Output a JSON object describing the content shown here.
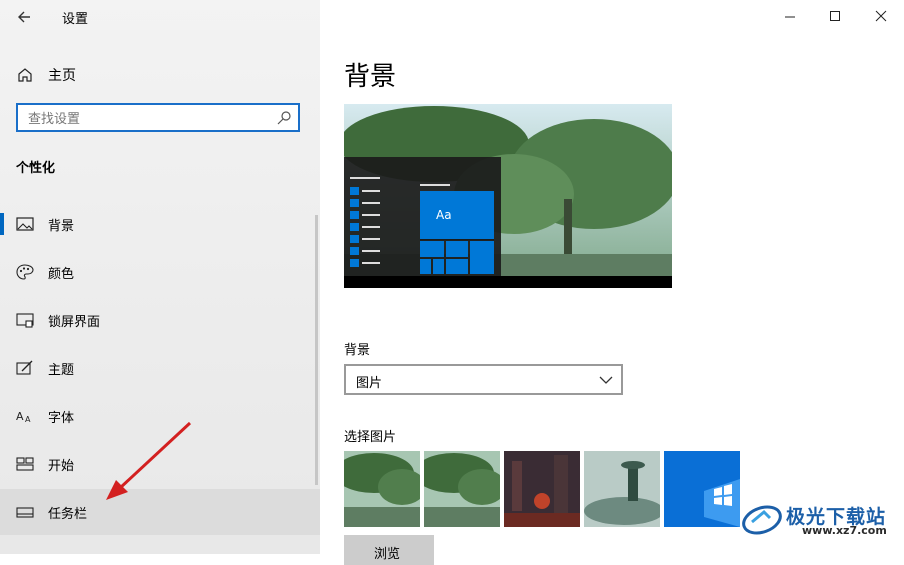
{
  "window": {
    "title": "设置"
  },
  "sidebar": {
    "home_label": "主页",
    "search_placeholder": "查找设置",
    "section_title": "个性化",
    "items": [
      {
        "label": "背景",
        "icon": "image-icon"
      },
      {
        "label": "颜色",
        "icon": "palette-icon"
      },
      {
        "label": "锁屏界面",
        "icon": "lock-screen-icon"
      },
      {
        "label": "主题",
        "icon": "theme-icon"
      },
      {
        "label": "字体",
        "icon": "font-icon"
      },
      {
        "label": "开始",
        "icon": "start-icon"
      },
      {
        "label": "任务栏",
        "icon": "taskbar-icon"
      }
    ]
  },
  "main": {
    "title": "背景",
    "preview_sample_text": "Aa",
    "background_label": "背景",
    "background_value": "图片",
    "choose_picture_label": "选择图片",
    "browse_label": "浏览"
  },
  "watermark": {
    "name": "极光下载站",
    "url": "www.xz7.com"
  },
  "colors": {
    "accent": "#0067c0",
    "tile_blue": "#0078d7"
  }
}
